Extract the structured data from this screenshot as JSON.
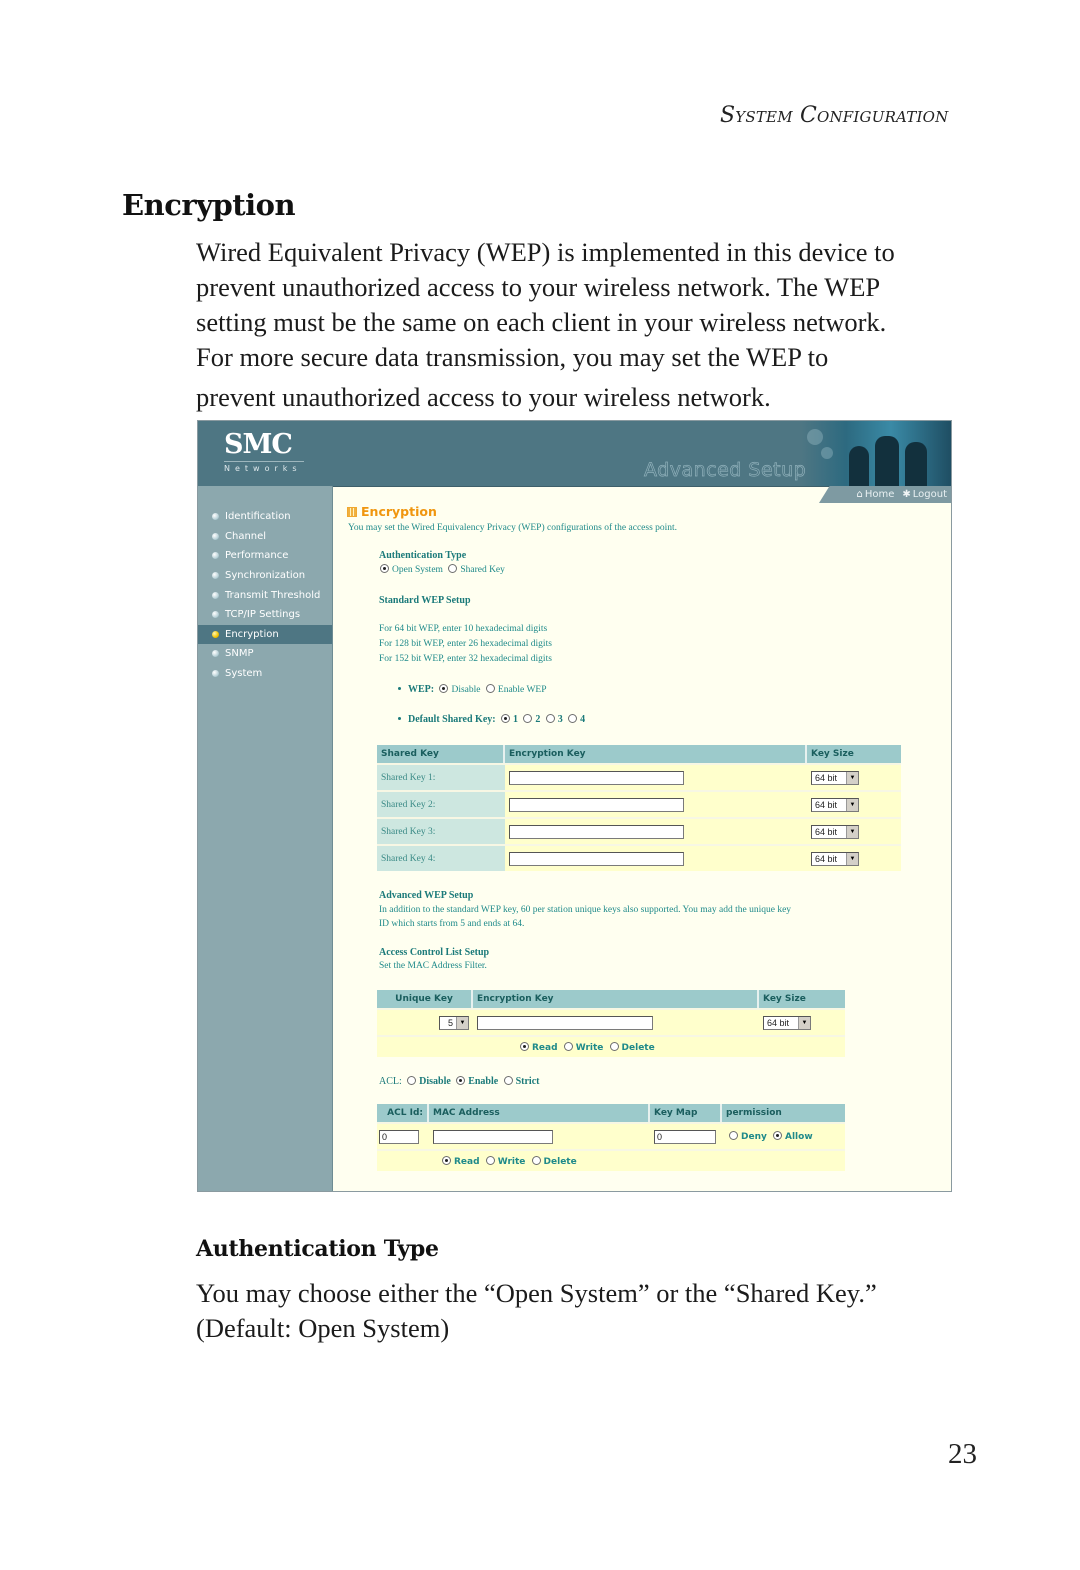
{
  "page": {
    "running_head": "System Configuration",
    "section_title": "Encryption",
    "intro_lines": [
      "Wired Equivalent Privacy (WEP) is implemented in this device to",
      "prevent unauthorized access to your wireless network. The WEP",
      "setting must be the same on each client in your wireless network.",
      "For more secure data transmission, you may set the WEP to"
    ],
    "intro_last_line": "prevent unauthorized access to your wireless network.",
    "subsection_title": "Authentication Type",
    "subsection_lines": [
      "You may choose either the “Open System” or the “Shared Key.”",
      "(Default: Open System)"
    ],
    "page_number": "23"
  },
  "screenshot": {
    "logo": {
      "main": "SMC",
      "sub": "Networks"
    },
    "banner_title": "Advanced Setup",
    "top_nav": [
      {
        "label": "Home",
        "icon": "home-icon"
      },
      {
        "label": "Logout",
        "icon": "logout-icon"
      }
    ],
    "sidebar": [
      {
        "label": "Identification",
        "active": false
      },
      {
        "label": "Channel",
        "active": false
      },
      {
        "label": "Performance",
        "active": false
      },
      {
        "label": "Synchronization",
        "active": false
      },
      {
        "label": "Transmit Threshold",
        "active": false
      },
      {
        "label": "TCP/IP Settings",
        "active": false
      },
      {
        "label": "Encryption",
        "active": true
      },
      {
        "label": "SNMP",
        "active": false
      },
      {
        "label": "System",
        "active": false
      }
    ],
    "title": "Encryption",
    "description": "You may set the Wired Equivalency Privacy (WEP) configurations of the access point.",
    "auth": {
      "label": "Authentication Type",
      "options": [
        {
          "label": "Open System",
          "selected": true
        },
        {
          "label": "Shared Key",
          "selected": false
        }
      ]
    },
    "standard_wep": {
      "label": "Standard WEP Setup",
      "hints": [
        "For 64 bit WEP, enter 10 hexadecimal digits",
        "For 128 bit WEP, enter 26 hexadecimal digits",
        "For 152 bit WEP, enter 32 hexadecimal digits"
      ],
      "wep_label": "WEP:",
      "wep_options": [
        {
          "label": "Disable",
          "selected": true
        },
        {
          "label": "Enable WEP",
          "selected": false
        }
      ],
      "default_key_label": "Default Shared Key:",
      "default_key_options": [
        {
          "label": "1",
          "selected": true
        },
        {
          "label": "2",
          "selected": false
        },
        {
          "label": "3",
          "selected": false
        },
        {
          "label": "4",
          "selected": false
        }
      ],
      "table": {
        "headers": [
          "Shared Key",
          "Encryption Key",
          "Key Size"
        ],
        "rows": [
          {
            "label": "Shared Key 1:",
            "key": "",
            "size": "64 bit"
          },
          {
            "label": "Shared Key 2:",
            "key": "",
            "size": "64 bit"
          },
          {
            "label": "Shared Key 3:",
            "key": "",
            "size": "64 bit"
          },
          {
            "label": "Shared Key 4:",
            "key": "",
            "size": "64 bit"
          }
        ]
      }
    },
    "advanced_wep": {
      "label": "Advanced WEP Setup",
      "text_line1": "In addition to the standard WEP key, 60 per station unique keys also supported. You may add the unique key",
      "text_line2": "ID which starts from 5 and ends at 64."
    },
    "acl_setup": {
      "label": "Access Control List Setup",
      "text": "Set the MAC Address Filter."
    },
    "unique_key_table": {
      "headers": [
        "Unique Key",
        "Encryption Key",
        "Key Size"
      ],
      "unique_key": "5",
      "encryption_key": "",
      "key_size": "64 bit",
      "actions": [
        {
          "label": "Read",
          "selected": true
        },
        {
          "label": "Write",
          "selected": false
        },
        {
          "label": "Delete",
          "selected": false
        }
      ]
    },
    "acl": {
      "label": "ACL:",
      "options": [
        {
          "label": "Disable",
          "selected": false
        },
        {
          "label": "Enable",
          "selected": true
        },
        {
          "label": "Strict",
          "selected": false
        }
      ]
    },
    "acl_table": {
      "headers": [
        "ACL Id:",
        "MAC Address",
        "Key Map",
        "permission"
      ],
      "acl_id": "0",
      "mac_address": "",
      "key_map": "0",
      "permission_options": [
        {
          "label": "Deny",
          "selected": false
        },
        {
          "label": "Allow",
          "selected": true
        }
      ],
      "actions": [
        {
          "label": "Read",
          "selected": true
        },
        {
          "label": "Write",
          "selected": false
        },
        {
          "label": "Delete",
          "selected": false
        }
      ]
    }
  }
}
